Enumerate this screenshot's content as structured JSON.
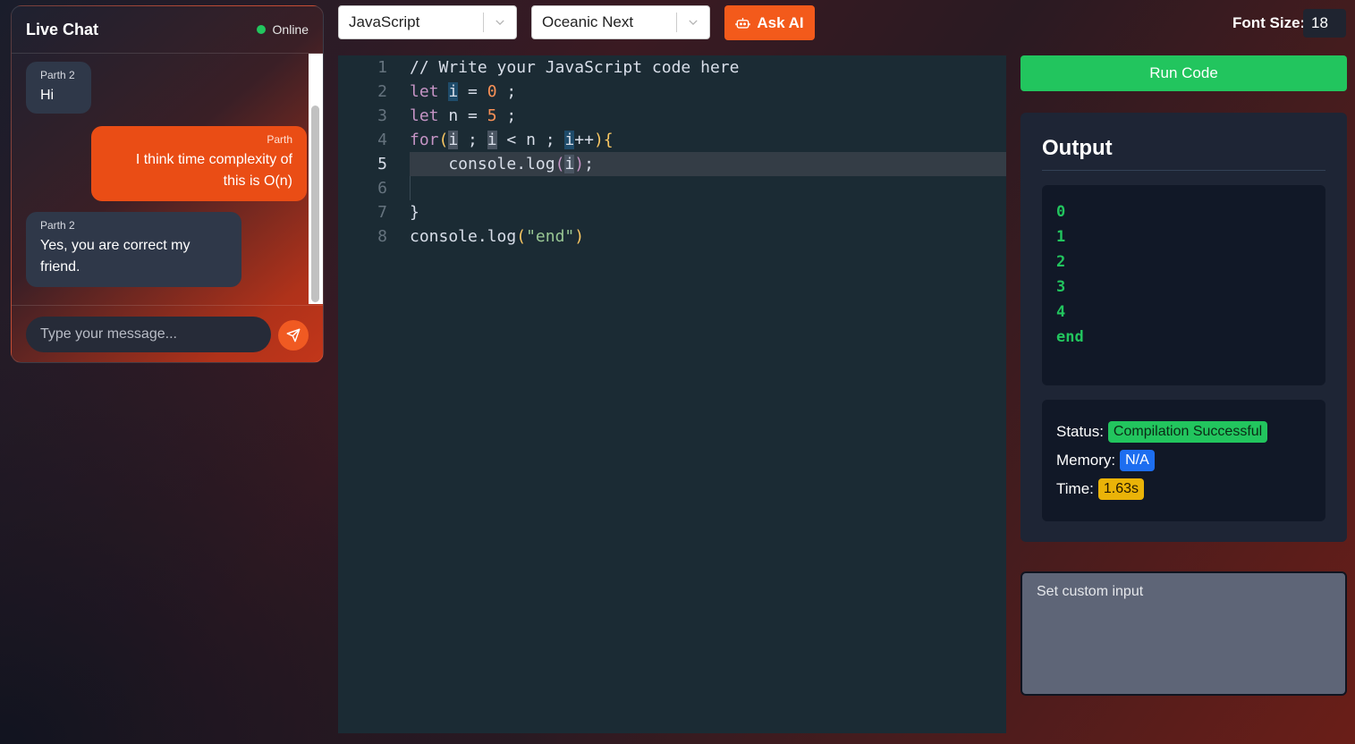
{
  "chat": {
    "title": "Live Chat",
    "status": "Online",
    "messages": [
      {
        "sender": "Parth 2",
        "text": "Hi",
        "side": "left"
      },
      {
        "sender": "Parth",
        "text_lines": [
          "I think time complexity of",
          "this is O(n)"
        ],
        "side": "right"
      },
      {
        "sender": "Parth 2",
        "text_lines": [
          "Yes, you are correct my",
          "friend."
        ],
        "side": "left"
      }
    ],
    "input_placeholder": "Type your message...",
    "send_icon": "send-icon"
  },
  "toolbar": {
    "language": "JavaScript",
    "theme": "Oceanic Next",
    "ask_ai_label": "Ask AI",
    "ask_ai_icon": "robot-icon",
    "font_size_label": "Font Size:",
    "font_size_value": "18"
  },
  "editor": {
    "line_numbers": [
      "1",
      "2",
      "3",
      "4",
      "5",
      "6",
      "7",
      "8"
    ],
    "active_line": 5,
    "lines": [
      "// Write your JavaScript code here",
      "let i = 0 ;",
      "let n = 5 ;",
      "for(i ; i < n ; i++){",
      "    console.log(i);",
      "",
      "}",
      "console.log(\"end\")"
    ]
  },
  "run": {
    "label": "Run Code"
  },
  "output": {
    "title": "Output",
    "lines": [
      "0",
      "1",
      "2",
      "3",
      "4",
      "end"
    ],
    "status_label": "Status:",
    "status_value": "Compilation Successful",
    "memory_label": "Memory:",
    "memory_value": "N/A",
    "time_label": "Time:",
    "time_value": "1.63s"
  },
  "custom_input": {
    "placeholder": "Set custom input"
  },
  "colors": {
    "accent_orange": "#f35a1b",
    "run_green": "#22c55e",
    "editor_bg": "#1b2b34"
  }
}
